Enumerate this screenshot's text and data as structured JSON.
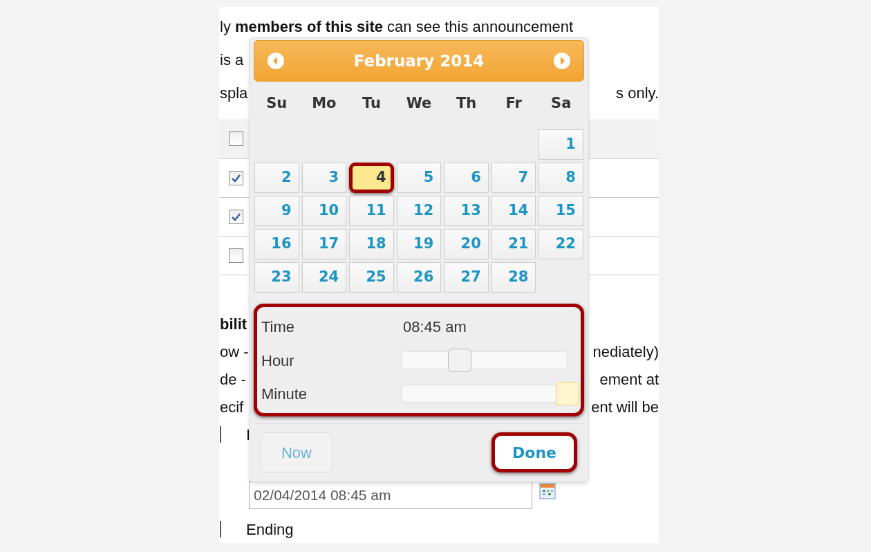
{
  "page": {
    "lines": [
      {
        "left": "ly **members of this site** can see this announcement"
      },
      {
        "left": "is a"
      },
      {
        "left": "spla",
        "right": "s only."
      }
    ],
    "table_rows": [
      {
        "kind": "header",
        "checked": false
      },
      {
        "kind": "row",
        "checked": true
      },
      {
        "kind": "row",
        "checked": true
      },
      {
        "kind": "row",
        "checked": false
      }
    ],
    "lines_below": [
      {
        "left": "bilit",
        "bold": true
      },
      {
        "left": "ow -",
        "right": "nediately)"
      },
      {
        "left": "de -",
        "right": "ement at"
      },
      {
        "left": "ecif",
        "right": "ent will be"
      },
      {
        "left": "I",
        "radio": true
      }
    ],
    "date_input": {
      "value": "02/04/2014 08:45 am"
    },
    "ending": {
      "label": "Ending"
    }
  },
  "datepicker": {
    "title": "February 2014",
    "weekdays": [
      "Su",
      "Mo",
      "Tu",
      "We",
      "Th",
      "Fr",
      "Sa"
    ],
    "weeks": [
      [
        {
          "kind": "empty"
        },
        {
          "kind": "empty"
        },
        {
          "kind": "empty"
        },
        {
          "kind": "empty"
        },
        {
          "kind": "empty"
        },
        {
          "kind": "empty"
        },
        {
          "day": "1",
          "selected": false,
          "highlighted": false
        }
      ],
      [
        {
          "day": "2",
          "selected": false,
          "highlighted": false
        },
        {
          "day": "3",
          "selected": false,
          "highlighted": false
        },
        {
          "day": "4",
          "selected": true,
          "highlighted": true
        },
        {
          "day": "5",
          "selected": false,
          "highlighted": false
        },
        {
          "day": "6",
          "selected": false,
          "highlighted": false
        },
        {
          "day": "7",
          "selected": false,
          "highlighted": false
        },
        {
          "day": "8",
          "selected": false,
          "highlighted": false
        }
      ],
      [
        {
          "day": "9",
          "selected": false,
          "highlighted": false
        },
        {
          "day": "10",
          "selected": false,
          "highlighted": false
        },
        {
          "day": "11",
          "selected": false,
          "highlighted": false
        },
        {
          "day": "12",
          "selected": false,
          "highlighted": false
        },
        {
          "day": "13",
          "selected": false,
          "highlighted": false
        },
        {
          "day": "14",
          "selected": false,
          "highlighted": false
        },
        {
          "day": "15",
          "selected": false,
          "highlighted": false
        }
      ],
      [
        {
          "day": "16",
          "selected": false,
          "highlighted": false
        },
        {
          "day": "17",
          "selected": false,
          "highlighted": false
        },
        {
          "day": "18",
          "selected": false,
          "highlighted": false
        },
        {
          "day": "19",
          "selected": false,
          "highlighted": false
        },
        {
          "day": "20",
          "selected": false,
          "highlighted": false
        },
        {
          "day": "21",
          "selected": false,
          "highlighted": false
        },
        {
          "day": "22",
          "selected": false,
          "highlighted": false
        }
      ],
      [
        {
          "day": "23",
          "selected": false,
          "highlighted": false
        },
        {
          "day": "24",
          "selected": false,
          "highlighted": false
        },
        {
          "day": "25",
          "selected": false,
          "highlighted": false
        },
        {
          "day": "26",
          "selected": false,
          "highlighted": false
        },
        {
          "day": "27",
          "selected": false,
          "highlighted": false
        },
        {
          "day": "28",
          "selected": false,
          "highlighted": false
        },
        {
          "kind": "empty"
        }
      ]
    ],
    "time": {
      "highlighted": true,
      "label": "Time",
      "value": "08:45 am",
      "sliders": [
        {
          "label": "Hour",
          "level": 0.35,
          "focused": false
        },
        {
          "label": "Minute",
          "level": 1,
          "focused": true
        }
      ]
    },
    "buttons": [
      {
        "label": "Now",
        "kind": "secondary",
        "highlighted": false
      },
      {
        "label": "Done",
        "kind": "primary",
        "highlighted": true
      }
    ]
  }
}
